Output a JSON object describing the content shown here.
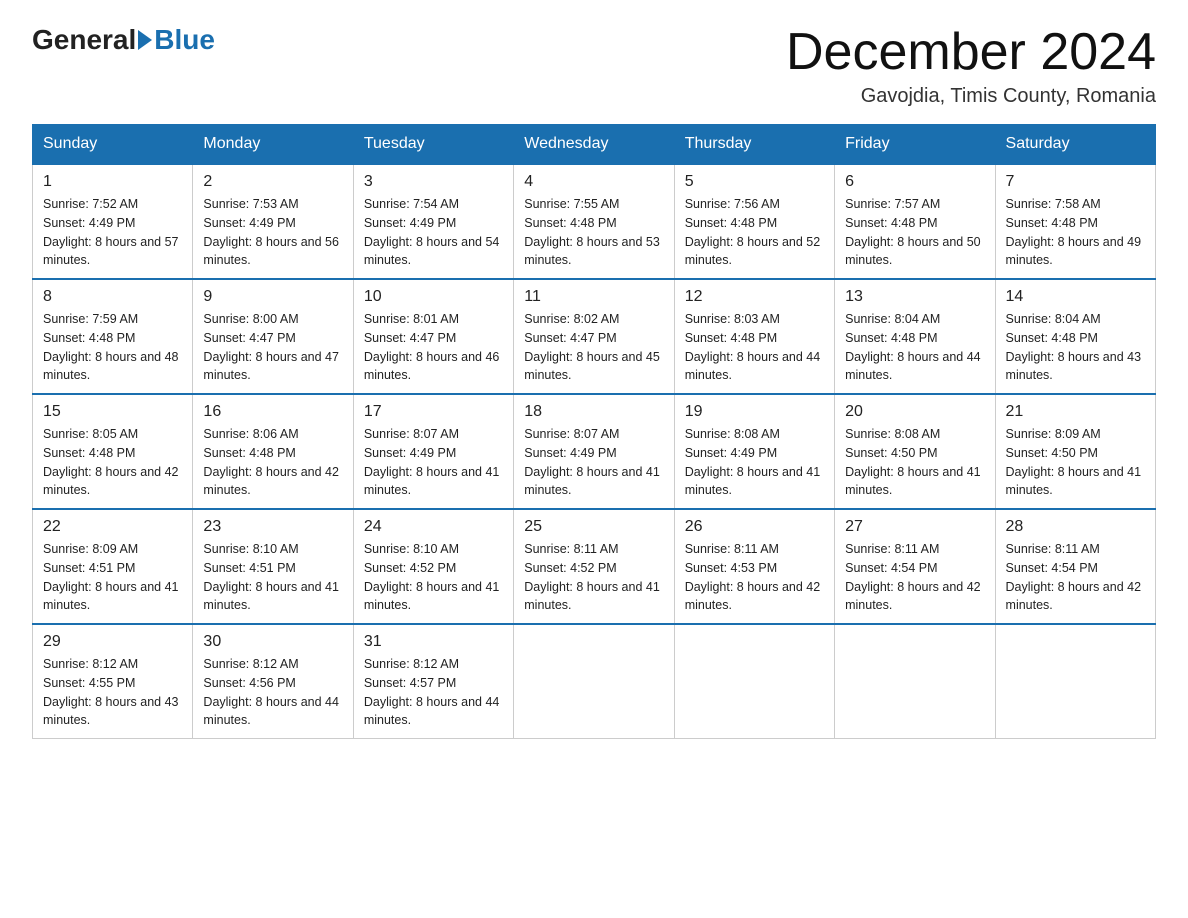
{
  "logo": {
    "general": "General",
    "blue": "Blue"
  },
  "header": {
    "month": "December 2024",
    "location": "Gavojdia, Timis County, Romania"
  },
  "days_of_week": [
    "Sunday",
    "Monday",
    "Tuesday",
    "Wednesday",
    "Thursday",
    "Friday",
    "Saturday"
  ],
  "weeks": [
    [
      {
        "day": "1",
        "sunrise": "7:52 AM",
        "sunset": "4:49 PM",
        "daylight": "8 hours and 57 minutes."
      },
      {
        "day": "2",
        "sunrise": "7:53 AM",
        "sunset": "4:49 PM",
        "daylight": "8 hours and 56 minutes."
      },
      {
        "day": "3",
        "sunrise": "7:54 AM",
        "sunset": "4:49 PM",
        "daylight": "8 hours and 54 minutes."
      },
      {
        "day": "4",
        "sunrise": "7:55 AM",
        "sunset": "4:48 PM",
        "daylight": "8 hours and 53 minutes."
      },
      {
        "day": "5",
        "sunrise": "7:56 AM",
        "sunset": "4:48 PM",
        "daylight": "8 hours and 52 minutes."
      },
      {
        "day": "6",
        "sunrise": "7:57 AM",
        "sunset": "4:48 PM",
        "daylight": "8 hours and 50 minutes."
      },
      {
        "day": "7",
        "sunrise": "7:58 AM",
        "sunset": "4:48 PM",
        "daylight": "8 hours and 49 minutes."
      }
    ],
    [
      {
        "day": "8",
        "sunrise": "7:59 AM",
        "sunset": "4:48 PM",
        "daylight": "8 hours and 48 minutes."
      },
      {
        "day": "9",
        "sunrise": "8:00 AM",
        "sunset": "4:47 PM",
        "daylight": "8 hours and 47 minutes."
      },
      {
        "day": "10",
        "sunrise": "8:01 AM",
        "sunset": "4:47 PM",
        "daylight": "8 hours and 46 minutes."
      },
      {
        "day": "11",
        "sunrise": "8:02 AM",
        "sunset": "4:47 PM",
        "daylight": "8 hours and 45 minutes."
      },
      {
        "day": "12",
        "sunrise": "8:03 AM",
        "sunset": "4:48 PM",
        "daylight": "8 hours and 44 minutes."
      },
      {
        "day": "13",
        "sunrise": "8:04 AM",
        "sunset": "4:48 PM",
        "daylight": "8 hours and 44 minutes."
      },
      {
        "day": "14",
        "sunrise": "8:04 AM",
        "sunset": "4:48 PM",
        "daylight": "8 hours and 43 minutes."
      }
    ],
    [
      {
        "day": "15",
        "sunrise": "8:05 AM",
        "sunset": "4:48 PM",
        "daylight": "8 hours and 42 minutes."
      },
      {
        "day": "16",
        "sunrise": "8:06 AM",
        "sunset": "4:48 PM",
        "daylight": "8 hours and 42 minutes."
      },
      {
        "day": "17",
        "sunrise": "8:07 AM",
        "sunset": "4:49 PM",
        "daylight": "8 hours and 41 minutes."
      },
      {
        "day": "18",
        "sunrise": "8:07 AM",
        "sunset": "4:49 PM",
        "daylight": "8 hours and 41 minutes."
      },
      {
        "day": "19",
        "sunrise": "8:08 AM",
        "sunset": "4:49 PM",
        "daylight": "8 hours and 41 minutes."
      },
      {
        "day": "20",
        "sunrise": "8:08 AM",
        "sunset": "4:50 PM",
        "daylight": "8 hours and 41 minutes."
      },
      {
        "day": "21",
        "sunrise": "8:09 AM",
        "sunset": "4:50 PM",
        "daylight": "8 hours and 41 minutes."
      }
    ],
    [
      {
        "day": "22",
        "sunrise": "8:09 AM",
        "sunset": "4:51 PM",
        "daylight": "8 hours and 41 minutes."
      },
      {
        "day": "23",
        "sunrise": "8:10 AM",
        "sunset": "4:51 PM",
        "daylight": "8 hours and 41 minutes."
      },
      {
        "day": "24",
        "sunrise": "8:10 AM",
        "sunset": "4:52 PM",
        "daylight": "8 hours and 41 minutes."
      },
      {
        "day": "25",
        "sunrise": "8:11 AM",
        "sunset": "4:52 PM",
        "daylight": "8 hours and 41 minutes."
      },
      {
        "day": "26",
        "sunrise": "8:11 AM",
        "sunset": "4:53 PM",
        "daylight": "8 hours and 42 minutes."
      },
      {
        "day": "27",
        "sunrise": "8:11 AM",
        "sunset": "4:54 PM",
        "daylight": "8 hours and 42 minutes."
      },
      {
        "day": "28",
        "sunrise": "8:11 AM",
        "sunset": "4:54 PM",
        "daylight": "8 hours and 42 minutes."
      }
    ],
    [
      {
        "day": "29",
        "sunrise": "8:12 AM",
        "sunset": "4:55 PM",
        "daylight": "8 hours and 43 minutes."
      },
      {
        "day": "30",
        "sunrise": "8:12 AM",
        "sunset": "4:56 PM",
        "daylight": "8 hours and 44 minutes."
      },
      {
        "day": "31",
        "sunrise": "8:12 AM",
        "sunset": "4:57 PM",
        "daylight": "8 hours and 44 minutes."
      },
      null,
      null,
      null,
      null
    ]
  ],
  "labels": {
    "sunrise": "Sunrise:",
    "sunset": "Sunset:",
    "daylight": "Daylight:"
  },
  "colors": {
    "header_bg": "#1a6faf",
    "border": "#1a6faf",
    "text": "#222"
  }
}
